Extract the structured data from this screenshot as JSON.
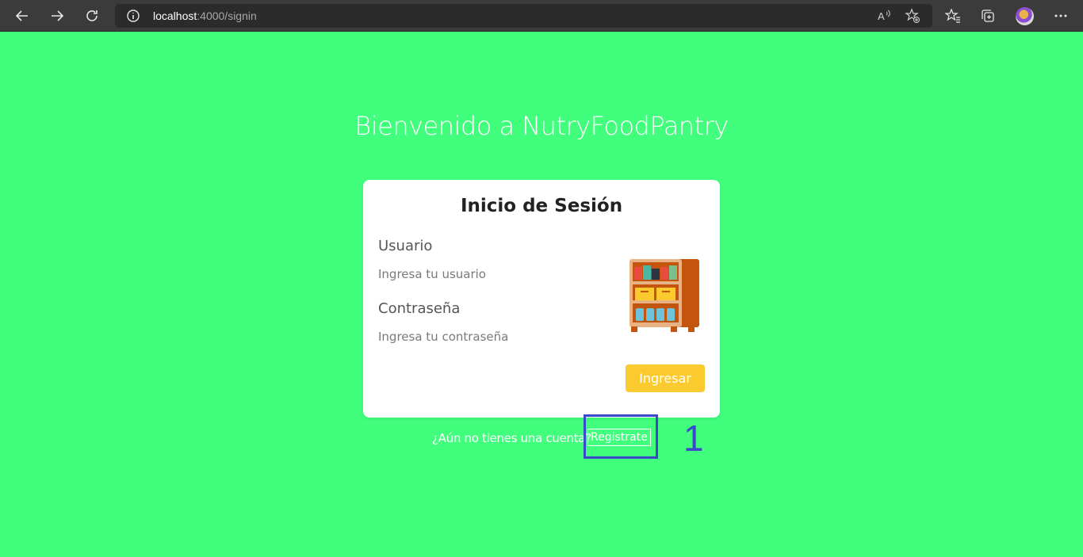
{
  "browser": {
    "url_host": "localhost",
    "url_path": ":4000/signin"
  },
  "page": {
    "welcome": "Bienvenido a NutryFoodPantry",
    "background_color": "#41ff7d"
  },
  "login_card": {
    "title": "Inicio de Sesión",
    "user_label": "Usuario",
    "user_placeholder": "Ingresa tu usuario",
    "password_label": "Contraseña",
    "password_placeholder": "Ingresa tu contraseña",
    "submit_label": "Ingresar",
    "submit_color": "#fbca2f"
  },
  "signup": {
    "question": "¿Aún no tienes una cuenta?",
    "link_label": "Registrate"
  },
  "annotation": {
    "number": "1",
    "color": "#3a49c9"
  }
}
